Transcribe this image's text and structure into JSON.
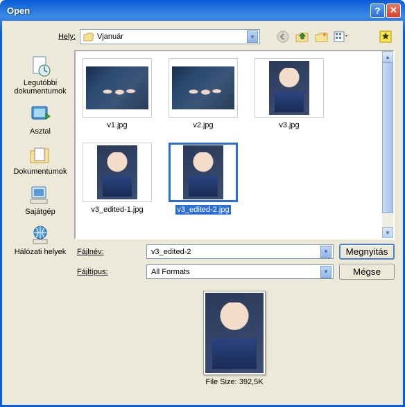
{
  "title": "Open",
  "location_label": "Hely:",
  "location_value": "Vjanuár",
  "sidebar": [
    {
      "label": "Legutóbbi dokumentumok",
      "icon": "recent"
    },
    {
      "label": "Asztal",
      "icon": "desktop"
    },
    {
      "label": "Dokumentumok",
      "icon": "documents"
    },
    {
      "label": "Sajátgép",
      "icon": "mycomputer"
    },
    {
      "label": "Hálózati helyek",
      "icon": "network"
    }
  ],
  "files": [
    {
      "name": "v1.jpg",
      "orientation": "landscape",
      "selected": false
    },
    {
      "name": "v2.jpg",
      "orientation": "landscape",
      "selected": false
    },
    {
      "name": "v3.jpg",
      "orientation": "portrait",
      "selected": false
    },
    {
      "name": "v3_edited-1.jpg",
      "orientation": "portrait",
      "selected": false
    },
    {
      "name": "v3_edited-2.jpg",
      "orientation": "portrait",
      "selected": true
    }
  ],
  "filename_label": "Fájlnév:",
  "filename_value": "v3_edited-2",
  "filetype_label": "Fájltípus:",
  "filetype_value": "All Formats",
  "open_button": "Megnyitás",
  "cancel_button": "Mégse",
  "preview_filesize_label": "File Size:",
  "preview_filesize_value": "392,5K"
}
